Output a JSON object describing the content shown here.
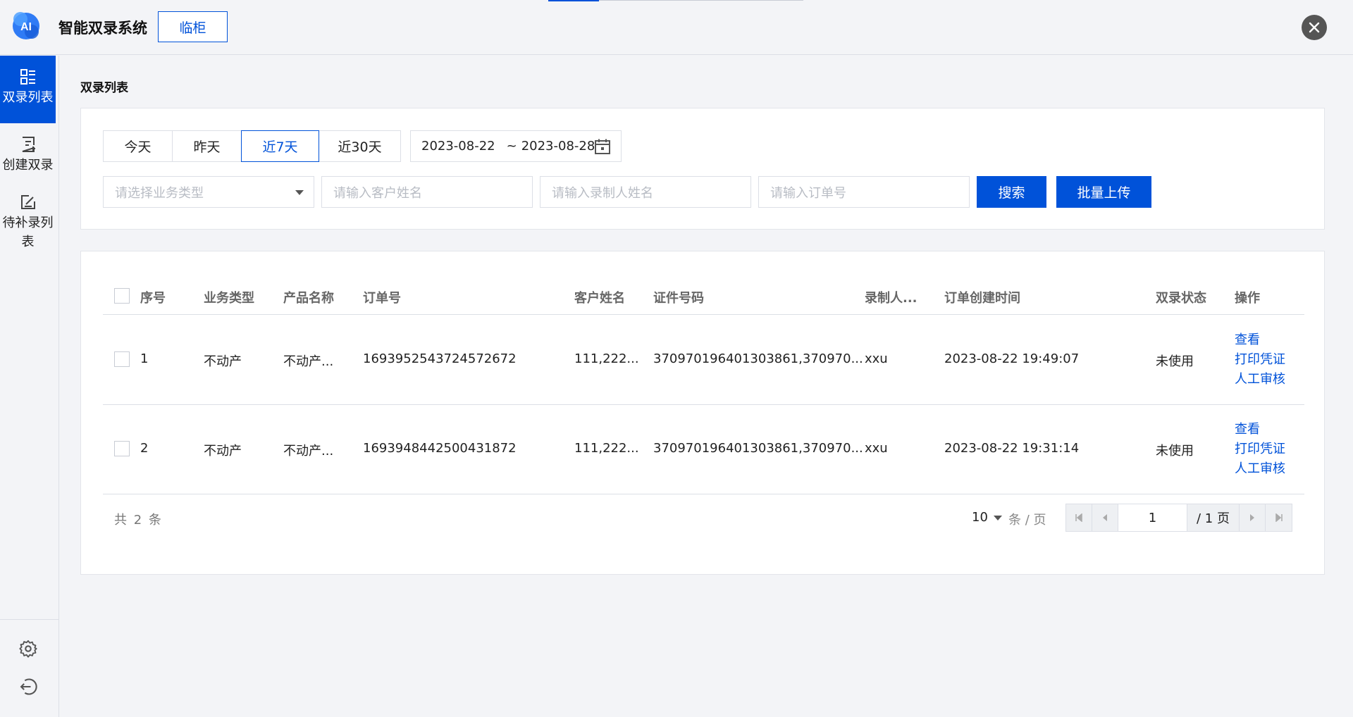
{
  "header": {
    "logo_text": "AI",
    "app_title": "智能双录系统",
    "mode_button": "临柜"
  },
  "sidebar": {
    "items": [
      {
        "label": "双录列表",
        "icon": "list-grid-icon",
        "active": true
      },
      {
        "label": "创建双录",
        "icon": "create-form-icon",
        "active": false
      },
      {
        "label": "待补录列表",
        "icon": "edit-square-icon",
        "active": false
      }
    ],
    "bottom_icons": [
      "settings-icon",
      "logout-icon"
    ]
  },
  "page": {
    "breadcrumb": "双录列表"
  },
  "filters": {
    "date_tabs": [
      {
        "label": "今天",
        "active": false
      },
      {
        "label": "昨天",
        "active": false
      },
      {
        "label": "近7天",
        "active": true
      },
      {
        "label": "近30天",
        "active": false
      }
    ],
    "date_start": "2023-08-22",
    "date_sep": "~",
    "date_end": "2023-08-28",
    "business_type_placeholder": "请选择业务类型",
    "customer_name_placeholder": "请输入客户姓名",
    "recorder_name_placeholder": "请输入录制人姓名",
    "order_no_placeholder": "请输入订单号",
    "search_label": "搜索",
    "batch_upload_label": "批量上传"
  },
  "table": {
    "headers": {
      "seq": "序号",
      "business_type": "业务类型",
      "product_name": "产品名称",
      "order_no": "订单号",
      "customer_name": "客户姓名",
      "id_number": "证件号码",
      "recorder": "录制人...",
      "created_time": "订单创建时间",
      "status": "双录状态",
      "actions": "操作"
    },
    "rows": [
      {
        "seq": "1",
        "business_type": "不动产",
        "product_name": "不动产...",
        "order_no": "1693952543724572672",
        "customer_name": "111,222...",
        "id_number": "370970196401303861,370970...",
        "recorder": "xxu",
        "created_time": "2023-08-22 19:49:07",
        "status": "未使用",
        "action_view": "查看",
        "action_print": "打印凭证",
        "action_review": "人工审核"
      },
      {
        "seq": "2",
        "business_type": "不动产",
        "product_name": "不动产...",
        "order_no": "1693948442500431872",
        "customer_name": "111,222...",
        "id_number": "370970196401303861,370970...",
        "recorder": "xxu",
        "created_time": "2023-08-22 19:31:14",
        "status": "未使用",
        "action_view": "查看",
        "action_print": "打印凭证",
        "action_review": "人工审核"
      }
    ]
  },
  "pagination": {
    "total_text": "共 2 条",
    "page_size": "10",
    "per_page_text": "条 / 页",
    "current_page": "1",
    "total_pages_text": "/ 1 页"
  },
  "colors": {
    "primary": "#0052d9",
    "background": "#f3f4f7"
  }
}
